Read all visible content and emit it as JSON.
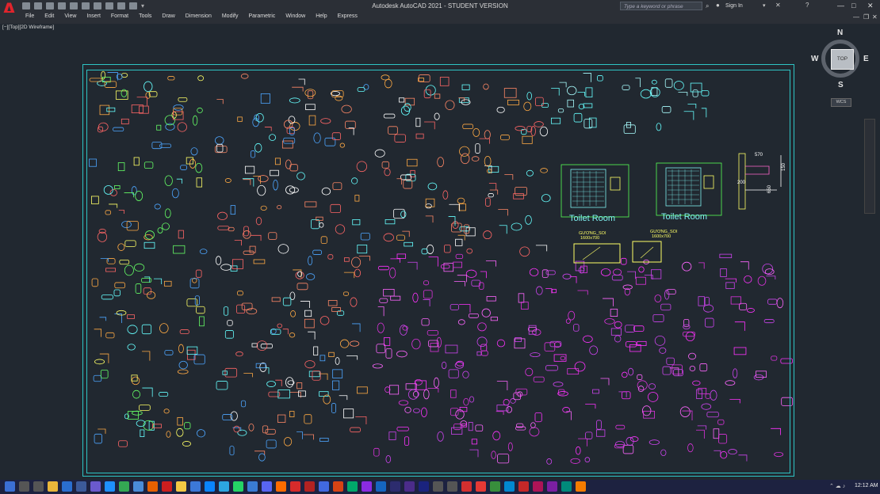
{
  "app": {
    "title": "Autodesk AutoCAD 2021 - STUDENT VERSION",
    "search_placeholder": "Type a keyword or phrase",
    "signin_label": "Sign In",
    "logo_glyph": "A"
  },
  "menu": {
    "items": [
      "File",
      "Edit",
      "View",
      "Insert",
      "Format",
      "Tools",
      "Draw",
      "Dimension",
      "Modify",
      "Parametric",
      "Window",
      "Help",
      "Express"
    ]
  },
  "viewport": {
    "label": "[−][Top][2D Wireframe]",
    "viewcube": {
      "top": "TOP",
      "n": "N",
      "s": "S",
      "e": "E",
      "w": "W"
    },
    "wcs_label": "WCS"
  },
  "drawing": {
    "room_labels": [
      "Toilet Room",
      "Toilet Room"
    ],
    "callouts": [
      "GƯƠNG_SOI",
      "1600x700",
      "GƯƠNG_SOI",
      "1600x700"
    ],
    "dimensions": [
      "570",
      "150",
      "200",
      "650"
    ],
    "frame_color": "#2ec4c4"
  },
  "taskbar": {
    "clock": "12:12 AM"
  },
  "colors": {
    "background": "#212830",
    "chrome": "#2b2f36",
    "taskbar": "#1d2240",
    "brand": "#e0242c"
  }
}
